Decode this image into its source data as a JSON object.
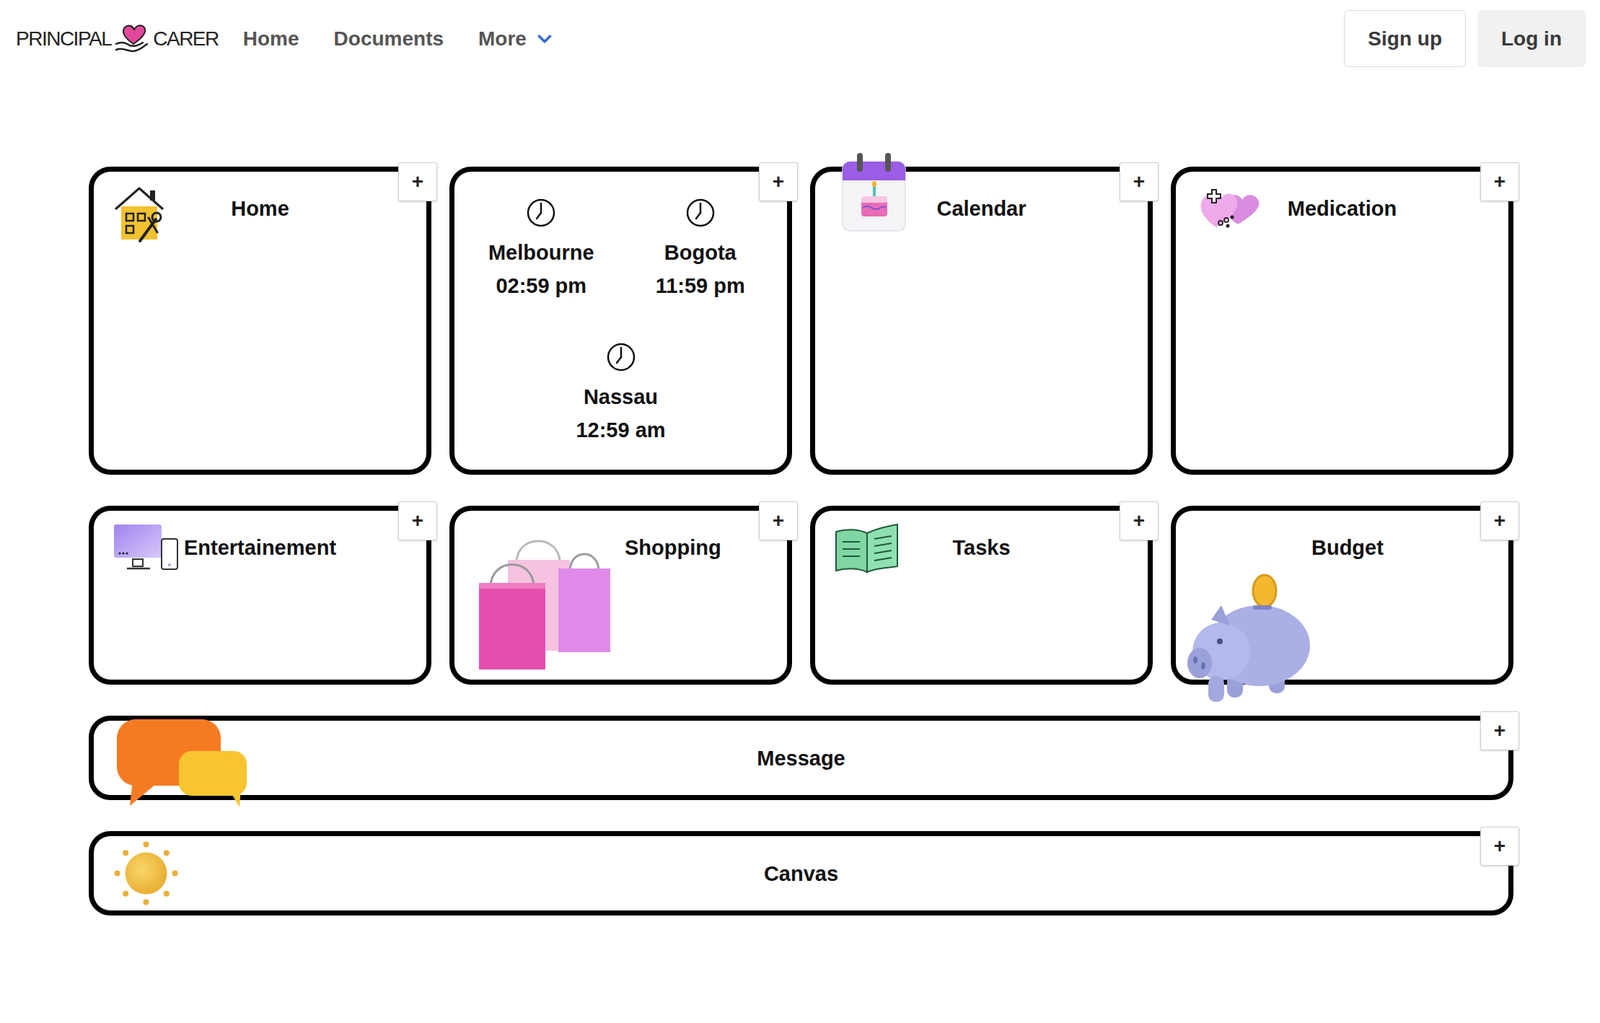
{
  "brand": {
    "left": "PRINCIPAL",
    "right": "CARER"
  },
  "nav": [
    {
      "label": "Home",
      "has_menu": false
    },
    {
      "label": "Documents",
      "has_menu": false
    },
    {
      "label": "More",
      "has_menu": true
    }
  ],
  "auth": [
    {
      "label": "Sign up",
      "kind": "outline"
    },
    {
      "label": "Log in",
      "kind": "filled"
    }
  ],
  "rows": [
    {
      "cards": [
        {
          "kind": "titled",
          "title": "Home",
          "action": "+"
        },
        {
          "kind": "clocks",
          "action": "+",
          "clocks": [
            {
              "city": "Melbourne",
              "time": "02:59 pm"
            },
            {
              "city": "Bogota",
              "time": "11:59 pm"
            },
            {
              "city": "Nassau",
              "time": "12:59 am"
            }
          ]
        },
        {
          "kind": "titled",
          "title": "Calendar",
          "action": "+"
        },
        {
          "kind": "titled",
          "title": "Medication",
          "action": "+"
        }
      ]
    },
    {
      "cards": [
        {
          "kind": "titled",
          "title": "Entertainement",
          "action": "+"
        },
        {
          "kind": "titled",
          "title": "Shopping",
          "action": "+"
        },
        {
          "kind": "titled",
          "title": "Tasks",
          "action": "+"
        },
        {
          "kind": "titled",
          "title": "Budget",
          "action": "+"
        }
      ]
    }
  ],
  "banners": [
    {
      "title": "Message",
      "action": "+"
    },
    {
      "title": "Canvas",
      "action": "+"
    }
  ]
}
